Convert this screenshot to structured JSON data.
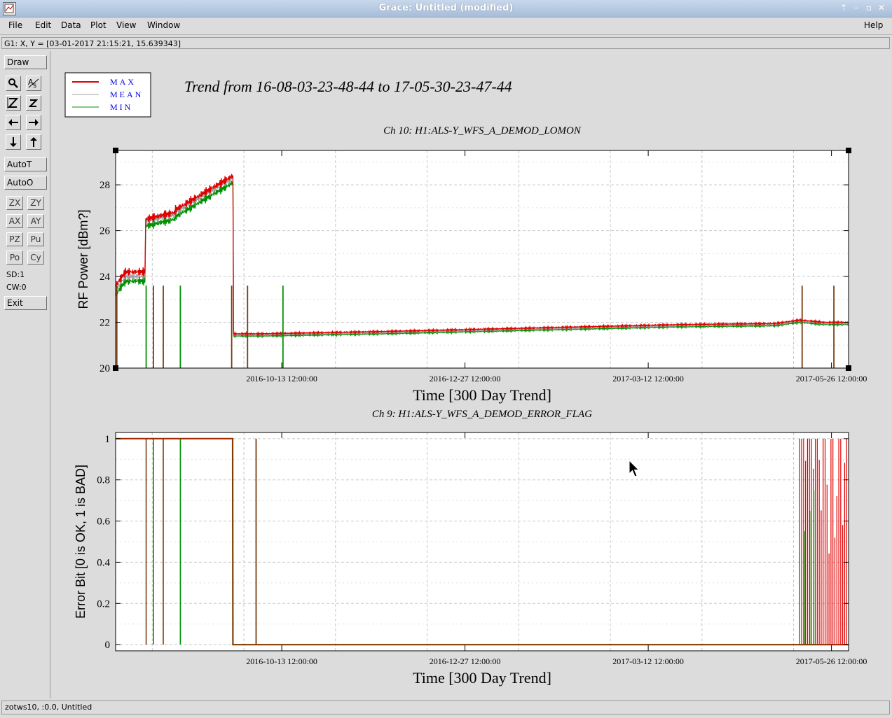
{
  "window": {
    "title": "Grace: Untitled (modified)",
    "controls": [
      "up-icon",
      "minimize-icon",
      "maximize-icon",
      "close-icon"
    ]
  },
  "menu": {
    "file": "File",
    "edit": "Edit",
    "data": "Data",
    "plot": "Plot",
    "view": "View",
    "window": "Window",
    "help": "Help"
  },
  "locator": "G1: X, Y = [03-01-2017 21:15:21, 15.639343]",
  "toolbar": {
    "draw": "Draw",
    "autot": "AutoT",
    "autoo": "AutoO",
    "zx": "ZX",
    "zy": "ZY",
    "ax": "AX",
    "ay": "AY",
    "pz": "PZ",
    "pu": "Pu",
    "po": "Po",
    "cy": "Cy",
    "sd": "SD:1",
    "cw": "CW:0",
    "exit": "Exit",
    "icons": [
      "zoom-icon",
      "text-icon",
      "autoscale-icon",
      "z-icon",
      "left-arrow-icon",
      "right-arrow-icon",
      "down-arrow-icon",
      "up-arrow-icon"
    ]
  },
  "plot": {
    "main_title": "Trend from 16-08-03-23-48-44 to 17-05-30-23-47-44",
    "legend": [
      {
        "label": "MAX",
        "color": "#e00000"
      },
      {
        "label": "MEAN",
        "color": "#a0a0a0"
      },
      {
        "label": "MIN",
        "color": "#009000"
      }
    ],
    "legend_text_color": "#0000e0"
  },
  "chart_data": [
    {
      "type": "line",
      "title": "Ch 10: H1:ALS-Y_WFS_A_DEMOD_LOMON",
      "xlabel": "Time [300 Day Trend]",
      "ylabel": "RF Power [dBm?]",
      "xticks": [
        "2016-10-13 12:00:00",
        "2016-12-27 12:00:00",
        "2017-03-12 12:00:00",
        "2017-05-26 12:00:00"
      ],
      "yticks": [
        20,
        22,
        24,
        26,
        28
      ],
      "xlim_days": [
        0,
        300
      ],
      "ylim": [
        20,
        29.5
      ],
      "grid": true,
      "series": [
        {
          "name": "MAX",
          "x_days": [
            0,
            4,
            12,
            12.3,
            24,
            24.3,
            48,
            48.3,
            60,
            110,
            150,
            190,
            230,
            270,
            280,
            290,
            300
          ],
          "values": [
            23.6,
            24.2,
            24.2,
            26.5,
            26.8,
            26.9,
            28.4,
            21.5,
            21.5,
            21.6,
            21.7,
            21.8,
            21.9,
            21.95,
            22.1,
            22.0,
            22.0
          ]
        },
        {
          "name": "MEAN",
          "x_days": [
            0,
            4,
            12,
            12.3,
            24,
            24.3,
            48,
            48.3,
            60,
            110,
            150,
            190,
            230,
            270,
            280,
            290,
            300
          ],
          "values": [
            23.4,
            24.0,
            24.0,
            26.4,
            26.7,
            26.8,
            28.3,
            21.45,
            21.45,
            21.55,
            21.65,
            21.75,
            21.85,
            21.9,
            22.05,
            21.95,
            21.95
          ]
        },
        {
          "name": "MIN",
          "x_days": [
            0,
            4,
            12,
            12.3,
            24,
            24.3,
            48,
            48.3,
            60,
            110,
            150,
            190,
            230,
            270,
            280,
            290,
            300
          ],
          "values": [
            23.2,
            23.8,
            23.8,
            26.2,
            26.5,
            26.6,
            28.1,
            21.4,
            21.4,
            21.5,
            21.6,
            21.7,
            21.8,
            21.85,
            22.0,
            21.9,
            21.9
          ]
        }
      ],
      "dropouts_days": [
        0.5,
        12.5,
        15.5,
        19.5,
        26.5,
        47.5,
        54,
        68.5,
        281,
        294
      ]
    },
    {
      "type": "line",
      "title": "Ch 9: H1:ALS-Y_WFS_A_DEMOD_ERROR_FLAG",
      "xlabel": "Time [300 Day Trend]",
      "ylabel": "Error Bit [0 is OK, 1 is BAD]",
      "xticks": [
        "2016-10-13 12:00:00",
        "2016-12-27 12:00:00",
        "2017-03-12 12:00:00",
        "2017-05-26 12:00:00"
      ],
      "yticks": [
        0,
        0.2,
        0.4,
        0.6,
        0.8,
        1
      ],
      "xlim_days": [
        0,
        300
      ],
      "ylim": [
        -0.03,
        1.03
      ],
      "grid": true,
      "series": [
        {
          "name": "MAX",
          "x_days": [
            0,
            47.9,
            48,
            300
          ],
          "values": [
            1,
            1,
            0,
            0
          ]
        },
        {
          "name": "MIN",
          "x_days": [
            0,
            47.9,
            48,
            300
          ],
          "values": [
            1,
            1,
            0,
            0
          ]
        }
      ],
      "pulses_days": [
        57.5
      ],
      "dropouts_days": [
        12.5,
        15.5,
        19.5,
        26.5
      ],
      "red_burst_days": [
        280,
        300
      ]
    }
  ],
  "status": "zotws10, :0.0, Untitled"
}
